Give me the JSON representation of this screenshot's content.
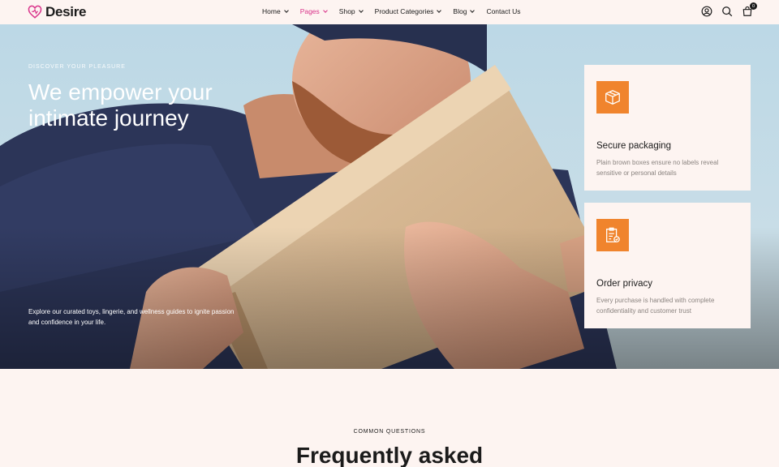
{
  "brand": {
    "name": "Desire",
    "accent": "#d9338a"
  },
  "nav": {
    "items": [
      {
        "label": "Home",
        "dropdown": true,
        "active": false
      },
      {
        "label": "Pages",
        "dropdown": true,
        "active": true
      },
      {
        "label": "Shop",
        "dropdown": true,
        "active": false
      },
      {
        "label": "Product Categories",
        "dropdown": true,
        "active": false
      },
      {
        "label": "Blog",
        "dropdown": true,
        "active": false
      },
      {
        "label": "Contact Us",
        "dropdown": false,
        "active": false
      }
    ]
  },
  "header_icons": {
    "account": "user-icon",
    "search": "search-icon",
    "cart": "cart-icon",
    "cart_count": "0"
  },
  "hero": {
    "eyebrow": "DISCOVER YOUR PLEASURE",
    "title": "We empower your intimate journey",
    "description": "Explore our curated toys, lingerie, and wellness guides to ignite passion and confidence in your life."
  },
  "cards": [
    {
      "icon": "package-icon",
      "title": "Secure packaging",
      "text": "Plain brown boxes ensure no labels reveal sensitive or personal details"
    },
    {
      "icon": "clipboard-check-icon",
      "title": "Order privacy",
      "text": "Every purchase is handled with complete confidentiality and customer trust"
    }
  ],
  "card_icon_color": "#f0842d",
  "faq": {
    "eyebrow": "COMMON QUESTIONS",
    "title": "Frequently asked"
  }
}
